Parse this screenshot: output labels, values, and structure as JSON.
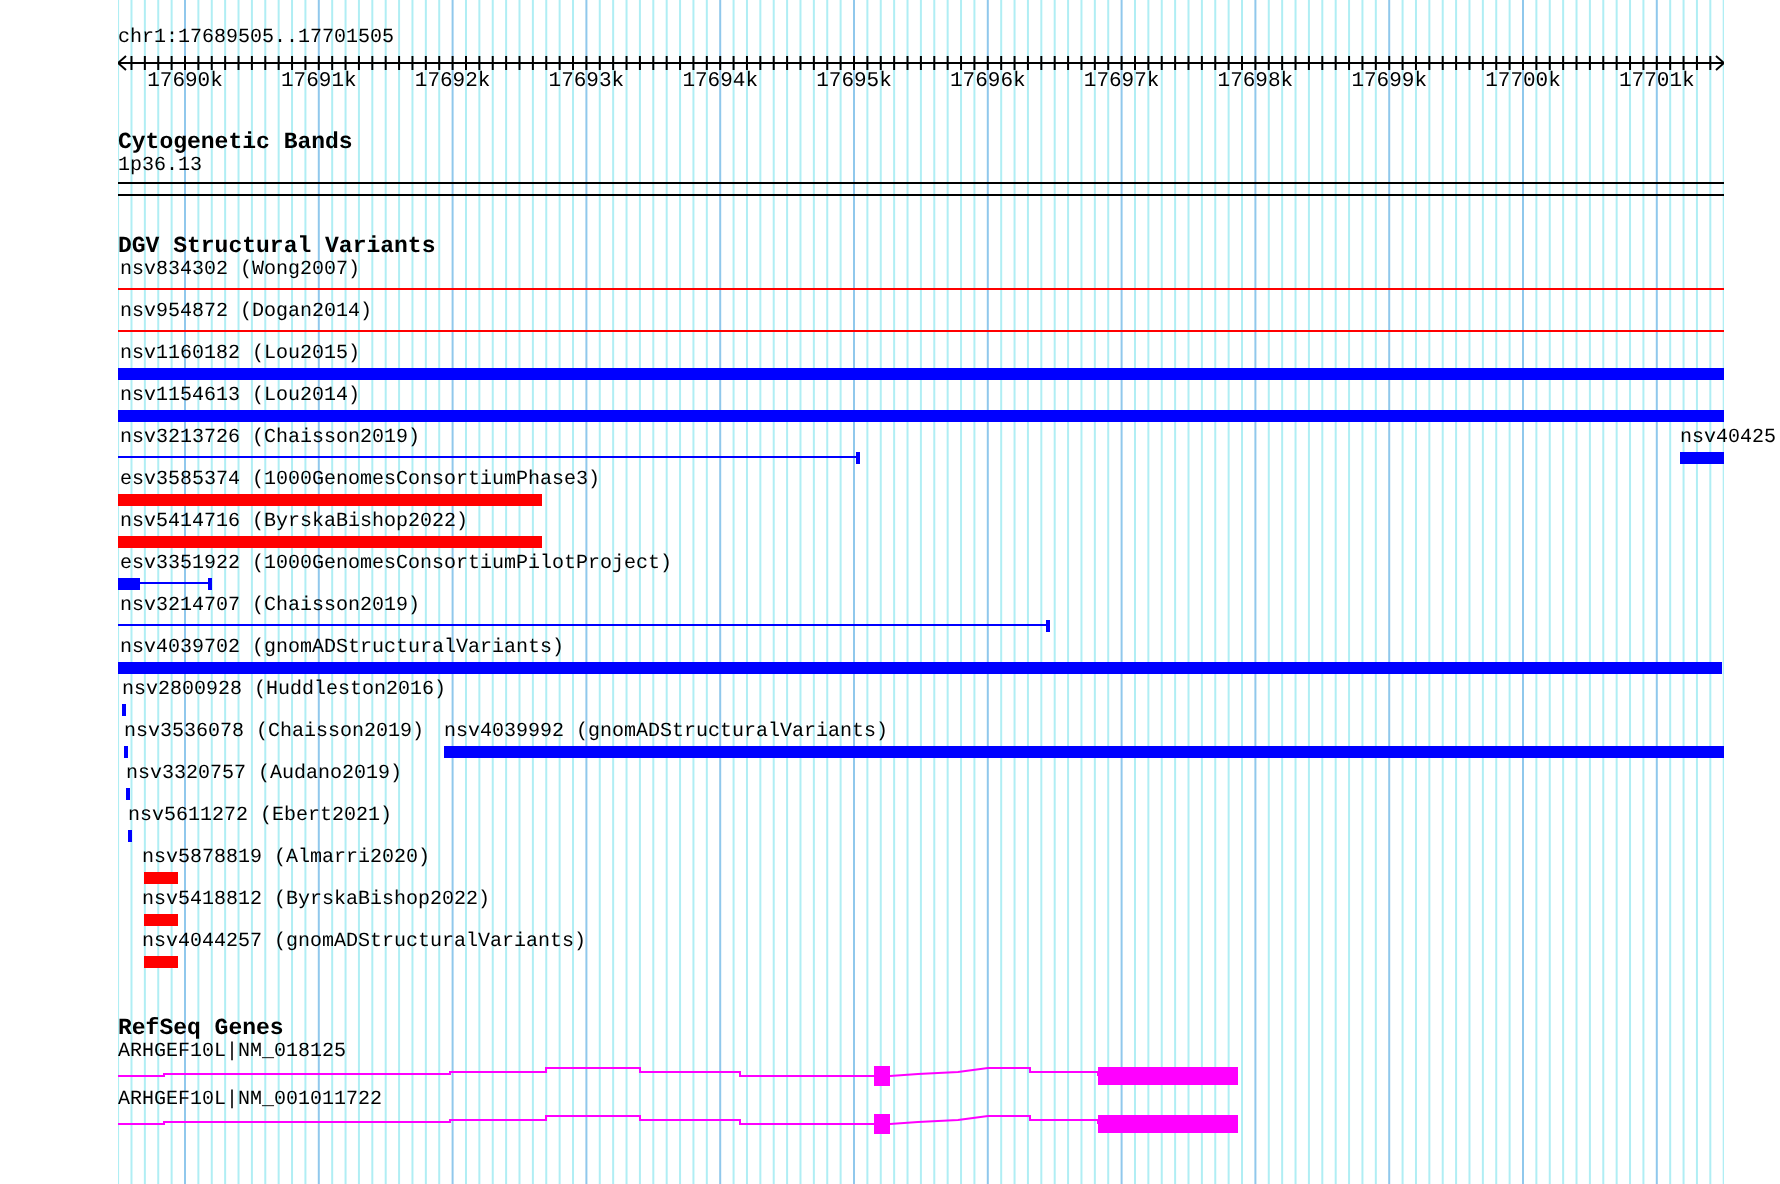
{
  "ruler": {
    "location": "chr1:17689505..17701505",
    "labels": [
      "17690k",
      "17691k",
      "17692k",
      "17693k",
      "17694k",
      "17695k",
      "17696k",
      "17697k",
      "17698k",
      "17699k",
      "17700k",
      "17701k"
    ]
  },
  "tracks": [
    {
      "kind": "cytoband",
      "title": "Cytogenetic Bands",
      "label": "1p36.13"
    },
    {
      "kind": "variants",
      "title": "DGV Structural Variants",
      "rows": [
        {
          "features": [
            {
              "label": "nsv834302 (Wong2007)",
              "kind": "line",
              "color": "#ff0000"
            }
          ]
        },
        {
          "features": [
            {
              "label": "nsv954872 (Dogan2014)",
              "kind": "line",
              "color": "#ff0000"
            }
          ]
        },
        {
          "features": [
            {
              "label": "nsv1160182 (Lou2015)",
              "kind": "thick",
              "color": "#0000ff"
            }
          ]
        },
        {
          "features": [
            {
              "label": "nsv1154613 (Lou2014)",
              "kind": "thick",
              "color": "#0000ff"
            }
          ]
        },
        {
          "features": [
            {
              "label": "nsv3213726 (Chaisson2019)",
              "kind": "thin",
              "color": "#0000ff"
            },
            {
              "label": "nsv40425",
              "kind": "thick",
              "color": "#0000ff"
            }
          ]
        },
        {
          "features": [
            {
              "label": "esv3585374 (1000GenomesConsortiumPhase3)",
              "kind": "thick",
              "color": "#ff0000"
            }
          ]
        },
        {
          "features": [
            {
              "label": "nsv5414716 (ByrskaBishop2022)",
              "kind": "thick",
              "color": "#ff0000"
            }
          ]
        },
        {
          "features": [
            {
              "label": "esv3351922 (1000GenomesConsortiumPilotProject)",
              "kind": "mixed",
              "color": "#0000ff"
            }
          ]
        },
        {
          "features": [
            {
              "label": "nsv3214707 (Chaisson2019)",
              "kind": "thin",
              "color": "#0000ff"
            }
          ]
        },
        {
          "features": [
            {
              "label": "nsv4039702 (gnomADStructuralVariants)",
              "kind": "thick",
              "color": "#0000ff"
            }
          ]
        },
        {
          "features": [
            {
              "label": "nsv2800928 (Huddleston2016)",
              "kind": "point",
              "color": "#0000ff"
            }
          ]
        },
        {
          "features": [
            {
              "label": "nsv3536078 (Chaisson2019)",
              "kind": "point",
              "color": "#0000ff"
            },
            {
              "label": "nsv4039992 (gnomADStructuralVariants)",
              "kind": "thick",
              "color": "#0000ff"
            }
          ]
        },
        {
          "features": [
            {
              "label": "nsv3320757 (Audano2019)",
              "kind": "point",
              "color": "#0000ff"
            }
          ]
        },
        {
          "features": [
            {
              "label": "nsv5611272 (Ebert2021)",
              "kind": "point",
              "color": "#0000ff"
            }
          ]
        },
        {
          "features": [
            {
              "label": "nsv5878819 (Almarri2020)",
              "kind": "thick",
              "color": "#ff0000"
            }
          ]
        },
        {
          "features": [
            {
              "label": "nsv5418812 (ByrskaBishop2022)",
              "kind": "thick",
              "color": "#ff0000"
            }
          ]
        },
        {
          "features": [
            {
              "label": "nsv4044257 (gnomADStructuralVariants)",
              "kind": "thick",
              "color": "#ff0000"
            }
          ]
        }
      ]
    },
    {
      "kind": "genes",
      "title": "RefSeq Genes",
      "genes": [
        {
          "label": "ARHGEF10L|NM_018125"
        },
        {
          "label": "ARHGEF10L|NM_001011722"
        }
      ]
    }
  ]
}
